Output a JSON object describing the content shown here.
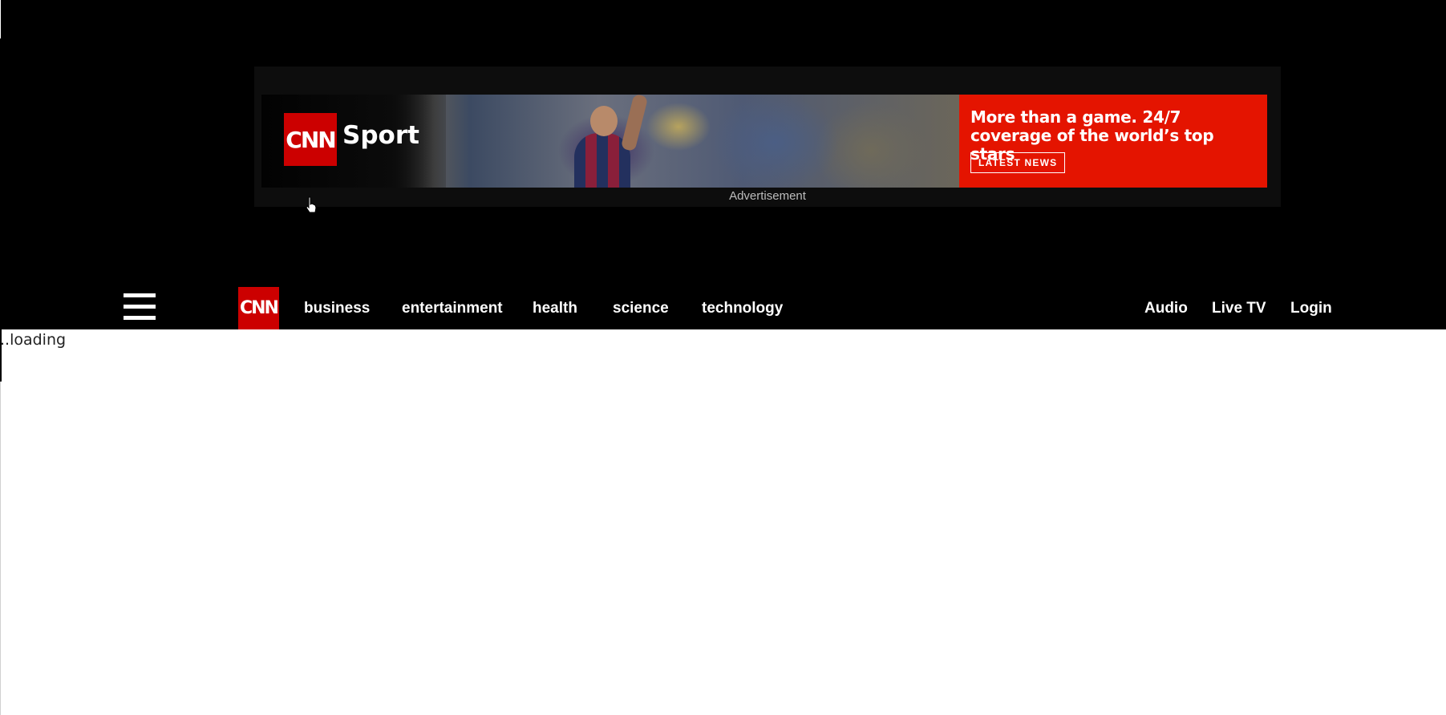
{
  "ad": {
    "brand_logo": "CNN",
    "brand_name": "Sport",
    "headline": "More than a game. 24/7 coverage of the world’s top stars",
    "cta_label": "LATEST NEWS",
    "label": "Advertisement",
    "colors": {
      "accent": "#e41400",
      "logo": "#cc0000"
    }
  },
  "nav": {
    "menu_icon": "hamburger-menu-icon",
    "logo": "CNN",
    "links": [
      "business",
      "entertainment",
      "health",
      "science",
      "technology"
    ],
    "right_links": [
      "Audio",
      "Live TV",
      "Login"
    ]
  },
  "content": {
    "status": "..loading"
  }
}
